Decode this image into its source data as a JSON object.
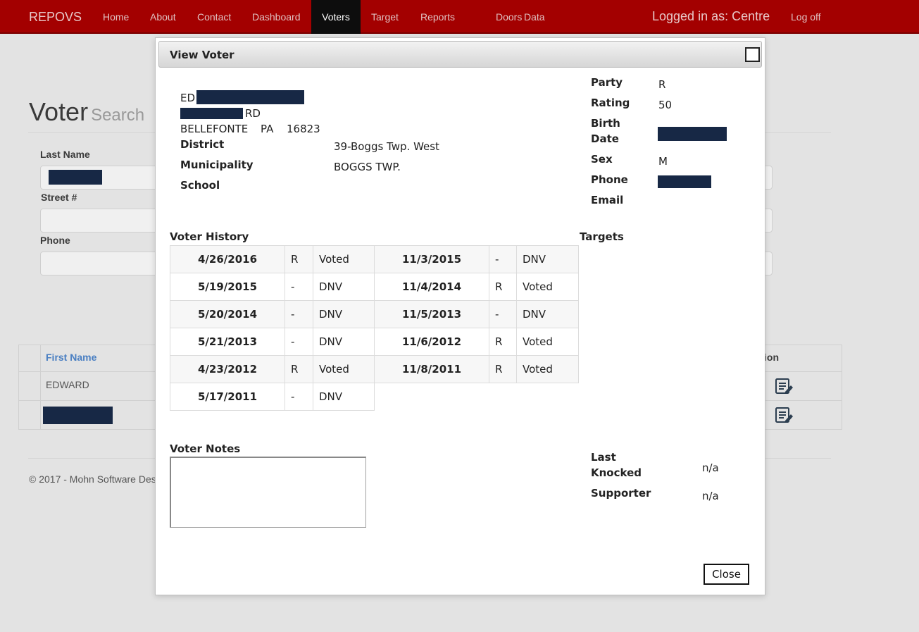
{
  "nav": {
    "brand": "REPOVS",
    "items": [
      "Home",
      "About",
      "Contact",
      "Dashboard",
      "Voters",
      "Target",
      "Reports",
      "Doors",
      "Data"
    ],
    "active": "Voters",
    "user": "Logged in as: Centre",
    "logoff": "Log off"
  },
  "page": {
    "title": "Voter",
    "subtitle": "Search",
    "labels": {
      "last_name": "Last Name",
      "street_num": "Street #",
      "phone": "Phone"
    },
    "table": {
      "headers": {
        "first_name": "First Name",
        "action": "ion"
      },
      "rows": [
        {
          "first_name": "EDWARD"
        }
      ]
    },
    "footer": "© 2017 - Mohn Software Des"
  },
  "dialog": {
    "title": "View Voter",
    "address": {
      "line1_prefix": "ED",
      "line2_suffix": "RD",
      "city": "BELLEFONTE",
      "state": "PA",
      "zip": "16823"
    },
    "district_label": "District",
    "district": "39-Boggs Twp. West",
    "municipality_label": "Municipality",
    "municipality": "BOGGS TWP.",
    "school_label": "School",
    "school": "",
    "party_label": "Party",
    "party": "R",
    "rating_label": "Rating",
    "rating": "50",
    "birth_label_1": "Birth",
    "birth_label_2": "Date",
    "sex_label": "Sex",
    "sex": "M",
    "phone_label": "Phone",
    "email_label": "Email",
    "history_label": "Voter History",
    "targets_label": "Targets",
    "history": [
      [
        {
          "date": "4/26/2016",
          "party": "R",
          "status": "Voted"
        },
        {
          "date": "11/3/2015",
          "party": "-",
          "status": "DNV"
        }
      ],
      [
        {
          "date": "5/19/2015",
          "party": "-",
          "status": "DNV"
        },
        {
          "date": "11/4/2014",
          "party": "R",
          "status": "Voted"
        }
      ],
      [
        {
          "date": "5/20/2014",
          "party": "-",
          "status": "DNV"
        },
        {
          "date": "11/5/2013",
          "party": "-",
          "status": "DNV"
        }
      ],
      [
        {
          "date": "5/21/2013",
          "party": "-",
          "status": "DNV"
        },
        {
          "date": "11/6/2012",
          "party": "R",
          "status": "Voted"
        }
      ],
      [
        {
          "date": "4/23/2012",
          "party": "R",
          "status": "Voted"
        },
        {
          "date": "11/8/2011",
          "party": "R",
          "status": "Voted"
        }
      ],
      [
        {
          "date": "5/17/2011",
          "party": "-",
          "status": "DNV"
        }
      ]
    ],
    "notes_label": "Voter Notes",
    "notes_value": "",
    "last_knocked_label_1": "Last",
    "last_knocked_label_2": "Knocked",
    "last_knocked": "n/a",
    "supporter_label": "Supporter",
    "supporter": "n/a",
    "close_label": "Close"
  },
  "colors": {
    "navbar": "#a30000",
    "nav_active": "#0d0d0d",
    "redaction": "#172845",
    "link_header": "#4a7fc2"
  }
}
